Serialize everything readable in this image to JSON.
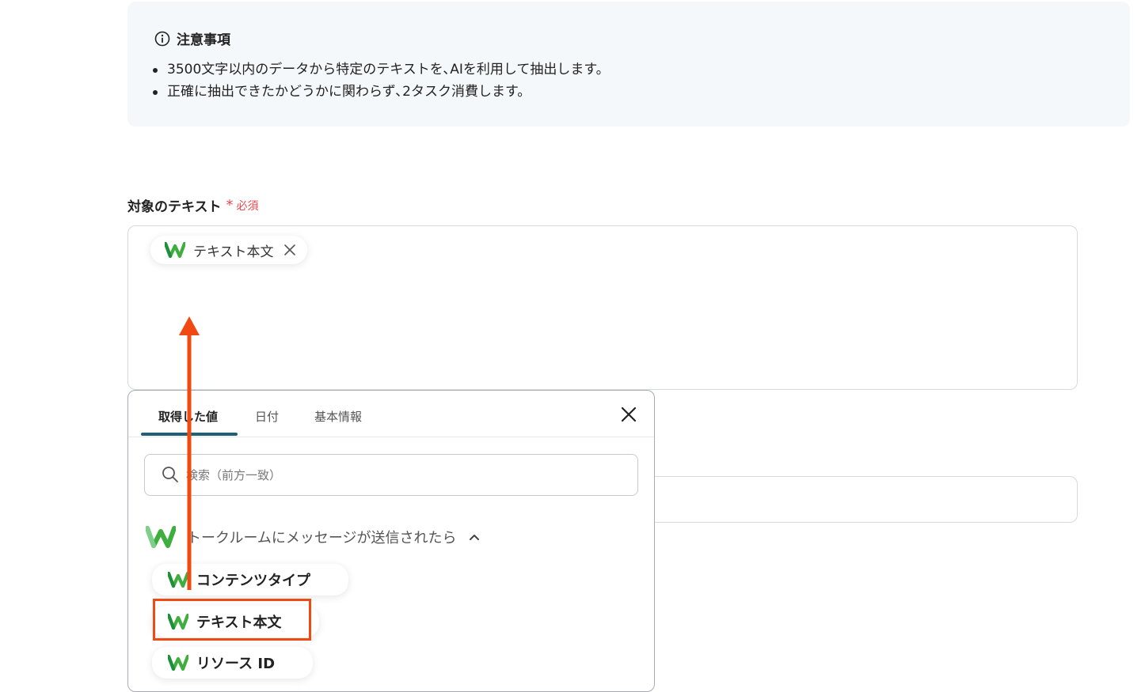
{
  "notice": {
    "title": "注意事項",
    "items": [
      "3500文字以内のデータから特定のテキストを､AIを利用して抽出します。",
      "正確に抽出できたかどうかに関わらず､2タスク消費します。"
    ]
  },
  "field": {
    "label": "対象のテキスト",
    "required_label": "必須",
    "selected_chip": "テキスト本文"
  },
  "popover": {
    "tabs": [
      {
        "label": "取得した値",
        "active": true
      },
      {
        "label": "日付",
        "active": false
      },
      {
        "label": "基本情報",
        "active": false
      }
    ],
    "search_placeholder": "検索（前方一致）",
    "group_label": "トークルームにメッセージが送信されたら",
    "options": [
      {
        "label": "コンテンツタイプ"
      },
      {
        "label": "テキスト本文",
        "highlighted": true
      },
      {
        "label": "リソース ID"
      }
    ]
  },
  "icons": {
    "notice": "info-icon",
    "chip_remove": "close-icon",
    "popover_close": "close-icon",
    "search": "search-icon",
    "group_toggle": "chevron-up-icon",
    "app_logo": "w-logo-icon",
    "annotation": "arrow-up-icon"
  },
  "colors": {
    "notice_bg": "#f5f8fb",
    "required": "#e5484d",
    "active_tab_underline": "#1f5f78",
    "annotation": "#f04a12",
    "logo_green": "#3fae3f"
  }
}
